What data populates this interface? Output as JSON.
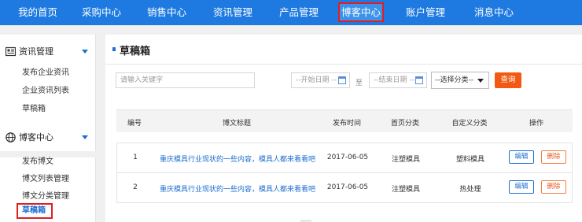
{
  "topnav": {
    "items": [
      {
        "label": "我的首页"
      },
      {
        "label": "采购中心"
      },
      {
        "label": "销售中心"
      },
      {
        "label": "资讯管理"
      },
      {
        "label": "产品管理"
      },
      {
        "label": "博客中心",
        "active": true
      },
      {
        "label": "账户管理"
      },
      {
        "label": "消息中心"
      }
    ]
  },
  "sidebar": {
    "sections": [
      {
        "title": "资讯管理",
        "icon": "news-icon",
        "links": [
          "发布企业资讯",
          "企业资讯列表",
          "草稿箱"
        ]
      },
      {
        "title": "博客中心",
        "icon": "globe-icon",
        "links": [
          "发布博文",
          "博文列表管理",
          "博文分类管理",
          "草稿箱"
        ]
      }
    ],
    "active_link": "草稿箱"
  },
  "main": {
    "title": "草稿箱",
    "search": {
      "keyword_placeholder": "请输入关键字",
      "start_date_placeholder": "--开始日期 --",
      "separator": "至",
      "end_date_placeholder": "--结束日期 --",
      "category_selected": "--选择分类--",
      "query_label": "查询"
    },
    "table": {
      "headers": [
        "编号",
        "博文标题",
        "发布时间",
        "首页分类",
        "自定义分类",
        "操作"
      ],
      "rows": [
        {
          "id": "1",
          "title": "重庆模具行业现状的一些内容，模具人都来看看吧",
          "date": "2017-06-05",
          "home_category": "注塑模具",
          "custom_category": "塑料模具",
          "edit": "编辑",
          "delete": "删除"
        },
        {
          "id": "2",
          "title": "重庆模具行业现状的一些内容，模具人都来看看吧",
          "date": "2017-06-05",
          "home_category": "注塑模具",
          "custom_category": "热处理",
          "edit": "编辑",
          "delete": "删除"
        }
      ]
    }
  },
  "colors": {
    "nav_bg": "#1e7ae0",
    "accent": "#1e6fd0",
    "query_button": "#f25a14",
    "highlight_box": "#e02020"
  }
}
